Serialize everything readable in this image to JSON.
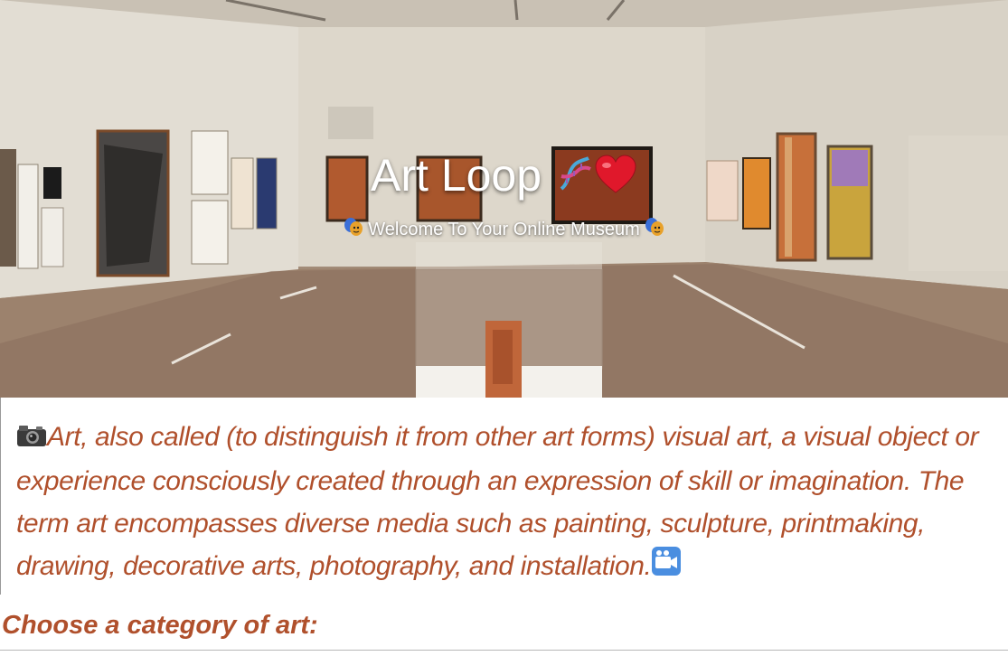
{
  "hero": {
    "title": "Art Loop",
    "subtitle": "Welcome To Your Online Museum"
  },
  "intro": {
    "text": "Art, also called (to distinguish it from other art forms) visual art, a visual object or experience consciously created through an expression of skill or imagination. The term art encompasses diverse media such as painting, sculpture, printmaking, drawing, decorative arts, photography, and installation."
  },
  "category": {
    "heading": "Choose a category of art:"
  },
  "colors": {
    "accent": "#b0502c",
    "title_text": "#ffffff"
  },
  "icons": [
    "camera-icon",
    "video-camera-icon",
    "dna-icon",
    "heart-icon",
    "theater-masks-icon"
  ]
}
